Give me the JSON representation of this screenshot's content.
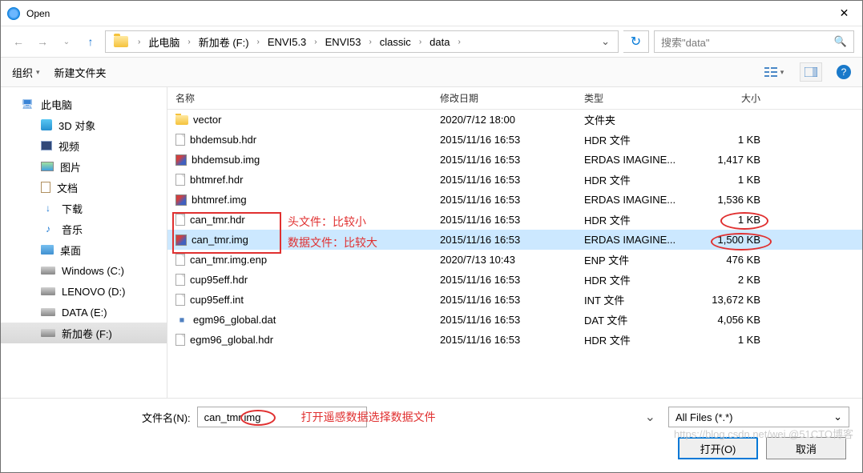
{
  "window": {
    "title": "Open"
  },
  "breadcrumb": [
    "此电脑",
    "新加卷 (F:)",
    "ENVI5.3",
    "ENVI53",
    "classic",
    "data"
  ],
  "search": {
    "placeholder": "搜索\"data\""
  },
  "toolbar": {
    "organize": "组织",
    "newfolder": "新建文件夹"
  },
  "sidebar": {
    "root": "此电脑",
    "items": [
      "3D 对象",
      "视频",
      "图片",
      "文档",
      "下载",
      "音乐",
      "桌面",
      "Windows (C:)",
      "LENOVO (D:)",
      "DATA (E:)",
      "新加卷 (F:)"
    ]
  },
  "columns": {
    "name": "名称",
    "date": "修改日期",
    "type": "类型",
    "size": "大小"
  },
  "rows": [
    {
      "icon": "folder",
      "name": "vector",
      "date": "2020/7/12 18:00",
      "type": "文件夹",
      "size": ""
    },
    {
      "icon": "file",
      "name": "bhdemsub.hdr",
      "date": "2015/11/16 16:53",
      "type": "HDR 文件",
      "size": "1 KB"
    },
    {
      "icon": "img",
      "name": "bhdemsub.img",
      "date": "2015/11/16 16:53",
      "type": "ERDAS IMAGINE...",
      "size": "1,417 KB"
    },
    {
      "icon": "file",
      "name": "bhtmref.hdr",
      "date": "2015/11/16 16:53",
      "type": "HDR 文件",
      "size": "1 KB"
    },
    {
      "icon": "img",
      "name": "bhtmref.img",
      "date": "2015/11/16 16:53",
      "type": "ERDAS IMAGINE...",
      "size": "1,536 KB"
    },
    {
      "icon": "file",
      "name": "can_tmr.hdr",
      "date": "2015/11/16 16:53",
      "type": "HDR 文件",
      "size": "1 KB"
    },
    {
      "icon": "img",
      "name": "can_tmr.img",
      "date": "2015/11/16 16:53",
      "type": "ERDAS IMAGINE...",
      "size": "1,500 KB",
      "sel": true
    },
    {
      "icon": "file",
      "name": "can_tmr.img.enp",
      "date": "2020/7/13 10:43",
      "type": "ENP 文件",
      "size": "476 KB"
    },
    {
      "icon": "file",
      "name": "cup95eff.hdr",
      "date": "2015/11/16 16:53",
      "type": "HDR 文件",
      "size": "2 KB"
    },
    {
      "icon": "file",
      "name": "cup95eff.int",
      "date": "2015/11/16 16:53",
      "type": "INT 文件",
      "size": "13,672 KB"
    },
    {
      "icon": "dat",
      "name": "egm96_global.dat",
      "date": "2015/11/16 16:53",
      "type": "DAT 文件",
      "size": "4,056 KB"
    },
    {
      "icon": "file",
      "name": "egm96_global.hdr",
      "date": "2015/11/16 16:53",
      "type": "HDR 文件",
      "size": "1 KB"
    }
  ],
  "filename": {
    "label": "文件名(N):",
    "value": "can_tmr.img"
  },
  "filter": "All Files (*.*)",
  "buttons": {
    "open": "打开(O)",
    "cancel": "取消"
  },
  "annotations": {
    "hdrNote": "头文件：比较小",
    "imgNote": "数据文件：比较大",
    "fnNote": "打开遥感数据选择数据文件"
  },
  "watermark": "https://blog.csdn.net/wei @51CTO博客"
}
